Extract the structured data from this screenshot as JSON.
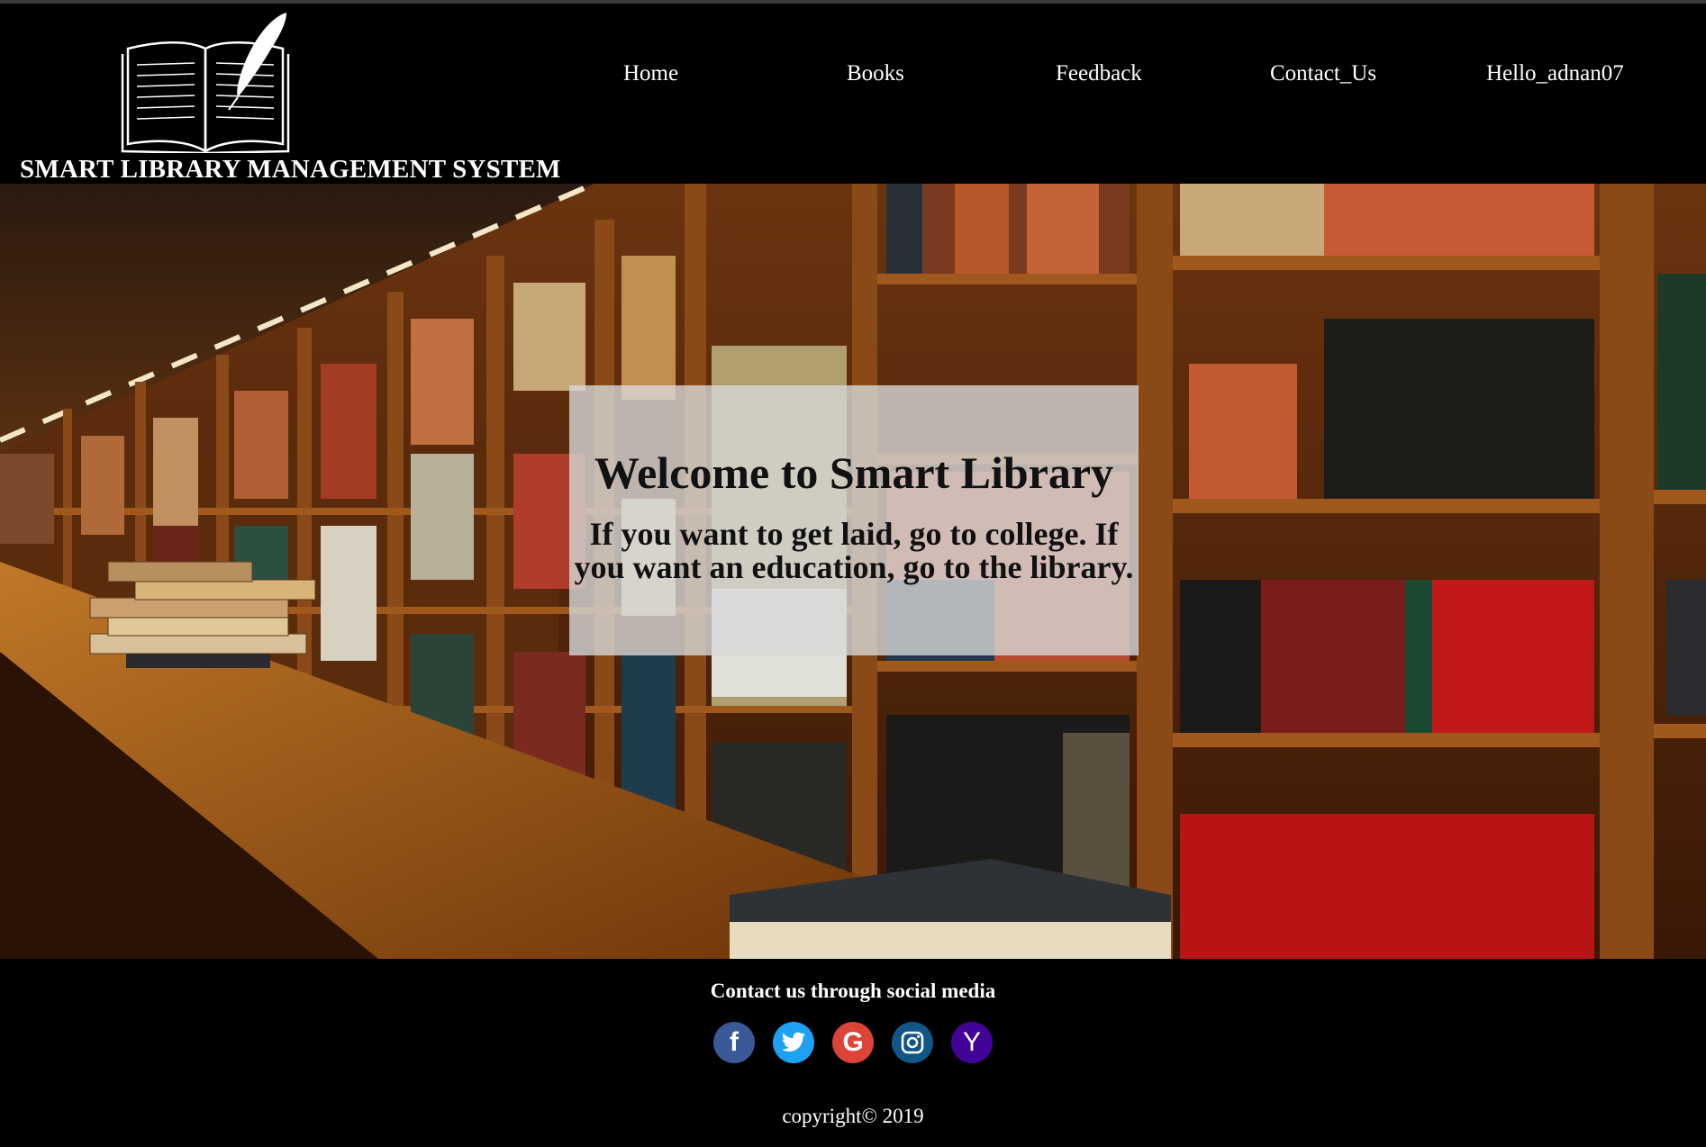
{
  "header": {
    "site_title": "SMART LIBRARY MANAGEMENT SYSTEM",
    "nav": [
      {
        "label": "Home"
      },
      {
        "label": "Books"
      },
      {
        "label": "Feedback"
      },
      {
        "label": "Contact_Us"
      },
      {
        "label": "Hello_adnan07"
      }
    ]
  },
  "hero": {
    "title": "Welcome to Smart Library",
    "quote": "If you want to get laid, go to college. If you want an education, go to the library."
  },
  "footer": {
    "social_heading": "Contact us through social media",
    "social": [
      {
        "icon": "facebook-icon",
        "glyph": "f",
        "color": "#3b5998"
      },
      {
        "icon": "twitter-icon",
        "glyph": "t",
        "color": "#1da1f2"
      },
      {
        "icon": "google-icon",
        "glyph": "G",
        "color": "#db4437"
      },
      {
        "icon": "instagram-icon",
        "glyph": "◎",
        "color": "#125688"
      },
      {
        "icon": "yahoo-icon",
        "glyph": "Y",
        "color": "#430297"
      }
    ],
    "copyright": "copyright©   2019"
  }
}
